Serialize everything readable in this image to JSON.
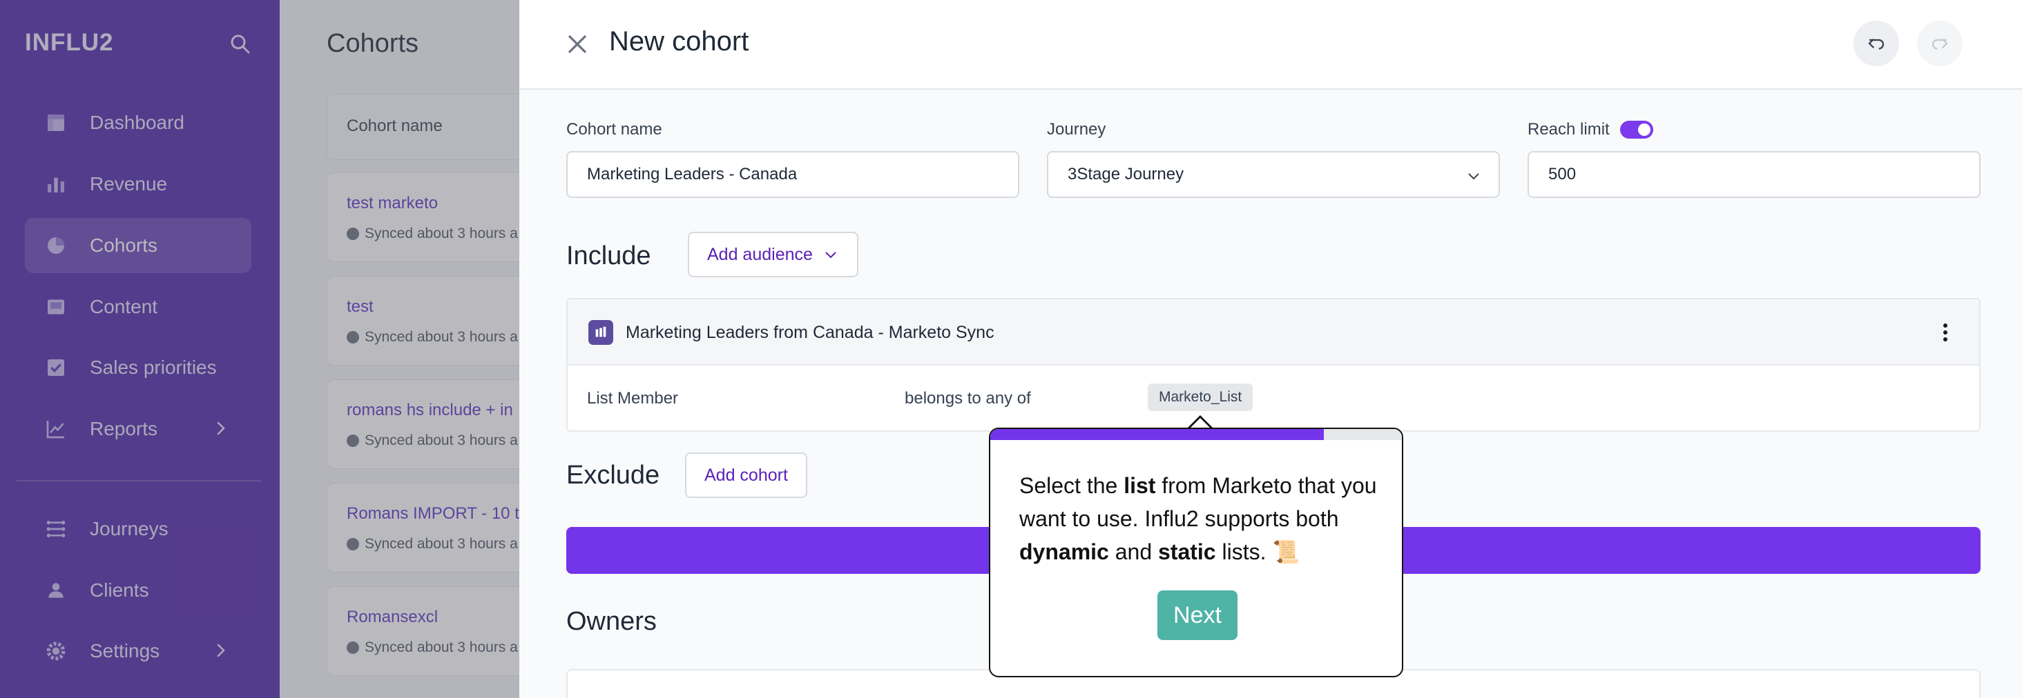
{
  "app": {
    "brand": "INFLU2"
  },
  "sidebar": {
    "items": [
      {
        "label": "Dashboard",
        "icon": "dashboard-icon"
      },
      {
        "label": "Revenue",
        "icon": "bar-chart-icon"
      },
      {
        "label": "Cohorts",
        "icon": "pie-chart-icon",
        "active": true
      },
      {
        "label": "Content",
        "icon": "content-icon"
      },
      {
        "label": "Sales priorities",
        "icon": "checkbox-icon"
      },
      {
        "label": "Reports",
        "icon": "line-chart-icon",
        "expandable": true
      },
      {
        "label": "Journeys",
        "icon": "journeys-icon"
      },
      {
        "label": "Clients",
        "icon": "clients-icon"
      },
      {
        "label": "Settings",
        "icon": "gear-icon",
        "expandable": true
      }
    ]
  },
  "background": {
    "title": "Cohorts",
    "column_header": "Cohort name",
    "rows": [
      {
        "name": "test marketo",
        "sync": "Synced about 3 hours a"
      },
      {
        "name": "test",
        "sync": "Synced about 3 hours a"
      },
      {
        "name": "romans hs include + in",
        "sync": "Synced about 3 hours a"
      },
      {
        "name": "Romans IMPORT - 10 t",
        "sync": "Synced about 3 hours a"
      },
      {
        "name": "Romansexcl",
        "sync": "Synced about 3 hours a"
      }
    ]
  },
  "panel": {
    "title": "New cohort",
    "fields": {
      "cohort_name": {
        "label": "Cohort name",
        "value": "Marketing Leaders - Canada"
      },
      "journey": {
        "label": "Journey",
        "value": "3Stage Journey"
      },
      "reach_limit": {
        "label": "Reach limit",
        "value": "500",
        "enabled": true
      }
    },
    "include": {
      "title": "Include",
      "add_button": "Add audience",
      "audience": {
        "name": "Marketing Leaders from Canada - Marketo Sync",
        "condition": {
          "field": "List Member",
          "operator": "belongs to any of",
          "value": "Marketo_List"
        }
      }
    },
    "exclude": {
      "title": "Exclude",
      "add_button": "Add cohort"
    },
    "owners": {
      "title": "Owners"
    }
  },
  "tour": {
    "progress": 0.81,
    "text_parts": [
      "Select the ",
      "list",
      " from Marketo that you want to use. Influ2 supports both ",
      "dynamic",
      " and ",
      "static",
      " lists. 📜"
    ],
    "next_label": "Next"
  },
  "colors": {
    "sidebar": "#4f27a8",
    "accent": "#7435ea",
    "next_button": "#4fb3a6"
  }
}
